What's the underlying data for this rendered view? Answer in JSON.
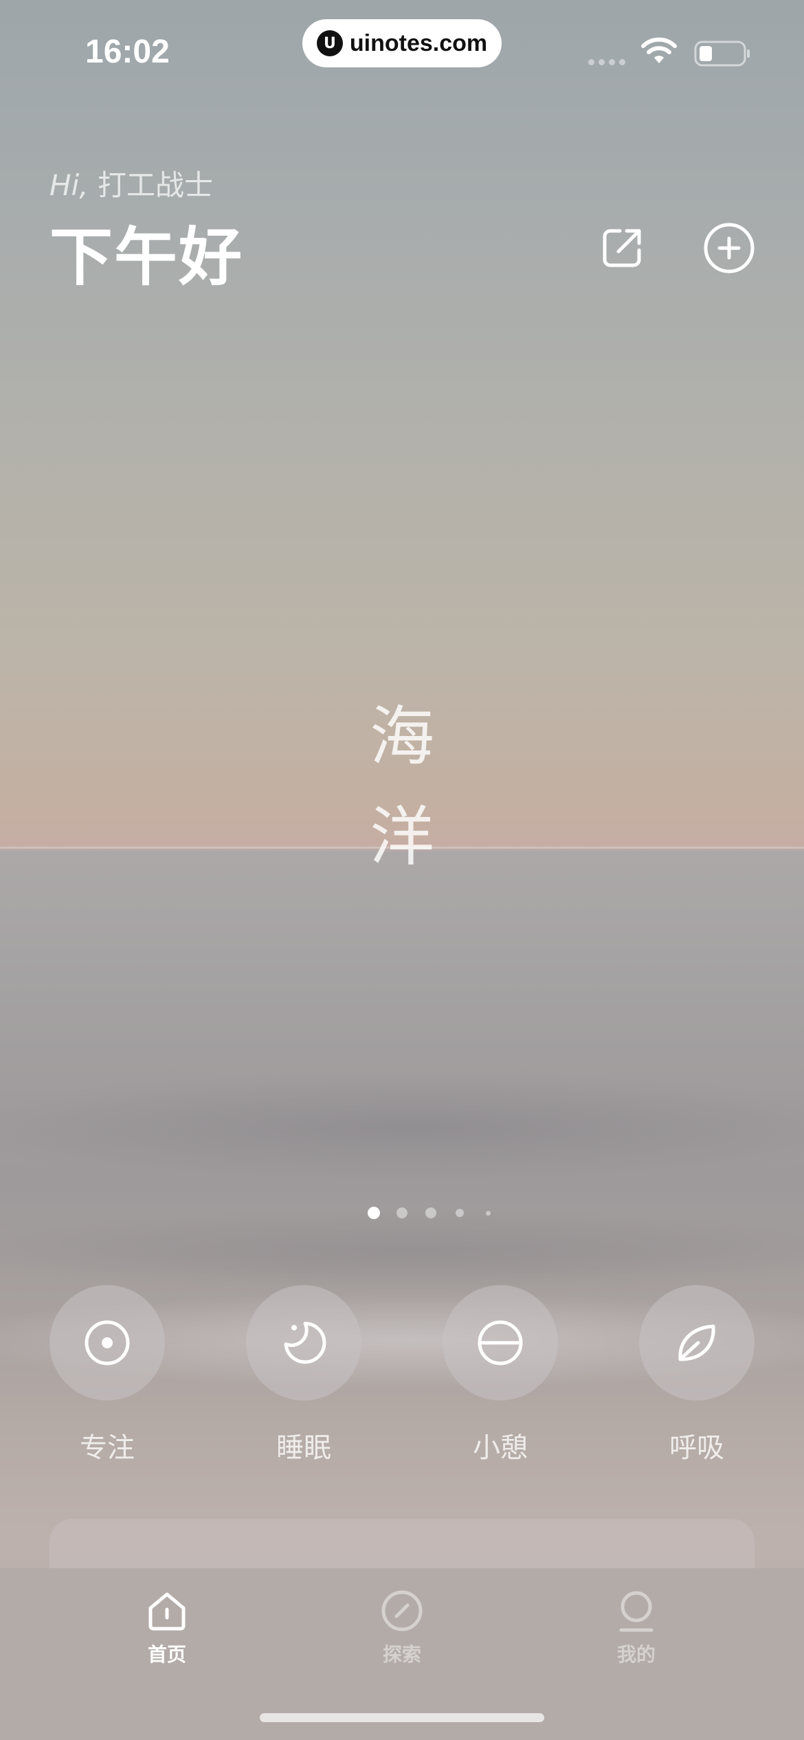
{
  "status_bar": {
    "time": "16:02",
    "url": "uinotes.com",
    "url_logo_glyph": "U",
    "icons": [
      "signal-icon",
      "wifi-icon",
      "battery-icon"
    ]
  },
  "header": {
    "greeting_prefix": "Hi,",
    "greeting_name": " 打工战士",
    "greeting_main": "下午好",
    "share_icon": "share-icon",
    "add_icon": "plus-circle-icon"
  },
  "scene": {
    "title_line1": "海",
    "title_line2": "洋",
    "page_count": 5,
    "active_page": 1
  },
  "modes": [
    {
      "label": "专注",
      "icon": "target-icon"
    },
    {
      "label": "睡眠",
      "icon": "moon-icon"
    },
    {
      "label": "小憩",
      "icon": "half-circle-icon"
    },
    {
      "label": "呼吸",
      "icon": "leaf-icon"
    }
  ],
  "tabbar": {
    "tabs": [
      {
        "label": "首页",
        "icon": "home-icon",
        "active": true
      },
      {
        "label": "探索",
        "icon": "compass-icon",
        "active": false
      },
      {
        "label": "我的",
        "icon": "profile-icon",
        "active": false
      }
    ]
  },
  "colors": {
    "accent": "#ffffff",
    "tabbar_bg": "#b3aba7"
  }
}
